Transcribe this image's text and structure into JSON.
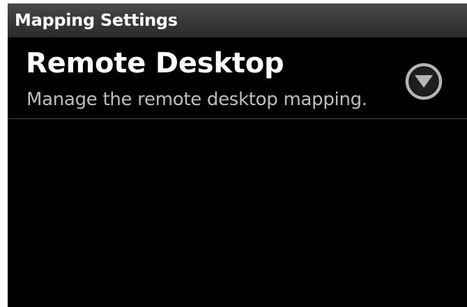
{
  "title_bar": {
    "title": "Mapping Settings"
  },
  "preference": {
    "title": "Remote Desktop",
    "summary": "Manage the remote desktop mapping.",
    "icon": "dropdown-arrow-circle-icon"
  },
  "colors": {
    "background": "#000000",
    "title_bar": "#3a3a3a",
    "title_text": "#ffffff",
    "summary_text": "#bdbdbd",
    "icon": "#b5b5b5",
    "divider": "#484848"
  }
}
